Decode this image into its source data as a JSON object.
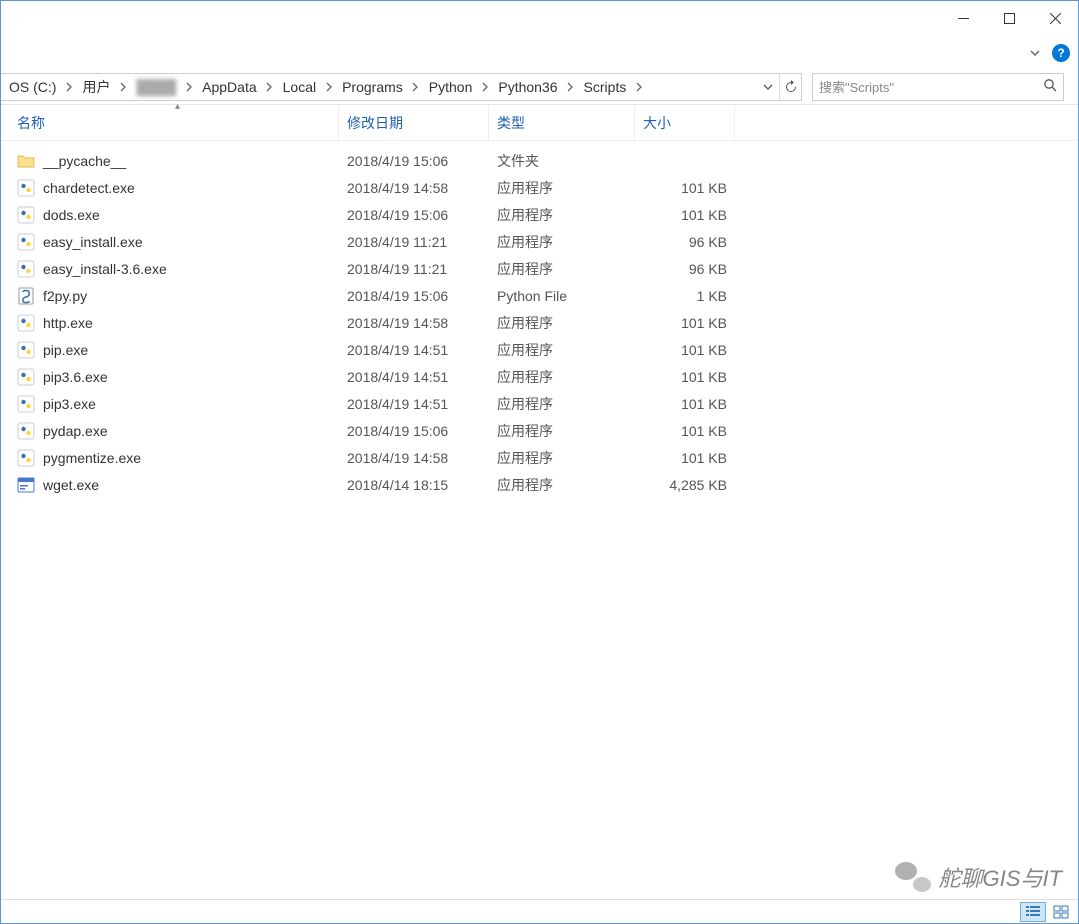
{
  "window": {
    "minimize": "—",
    "maximize": "☐",
    "close": "✕"
  },
  "help": "?",
  "breadcrumb": [
    "OS (C:)",
    "用户",
    "████",
    "AppData",
    "Local",
    "Programs",
    "Python",
    "Python36",
    "Scripts"
  ],
  "search_placeholder": "搜索\"Scripts\"",
  "columns": {
    "name": "名称",
    "date": "修改日期",
    "type": "类型",
    "size": "大小"
  },
  "files": [
    {
      "icon": "folder",
      "name": "__pycache__",
      "date": "2018/4/19 15:06",
      "type": "文件夹",
      "size": ""
    },
    {
      "icon": "exe",
      "name": "chardetect.exe",
      "date": "2018/4/19 14:58",
      "type": "应用程序",
      "size": "101 KB"
    },
    {
      "icon": "exe",
      "name": "dods.exe",
      "date": "2018/4/19 15:06",
      "type": "应用程序",
      "size": "101 KB"
    },
    {
      "icon": "exe",
      "name": "easy_install.exe",
      "date": "2018/4/19 11:21",
      "type": "应用程序",
      "size": "96 KB"
    },
    {
      "icon": "exe",
      "name": "easy_install-3.6.exe",
      "date": "2018/4/19 11:21",
      "type": "应用程序",
      "size": "96 KB"
    },
    {
      "icon": "py",
      "name": "f2py.py",
      "date": "2018/4/19 15:06",
      "type": "Python File",
      "size": "1 KB"
    },
    {
      "icon": "exe",
      "name": "http.exe",
      "date": "2018/4/19 14:58",
      "type": "应用程序",
      "size": "101 KB"
    },
    {
      "icon": "exe",
      "name": "pip.exe",
      "date": "2018/4/19 14:51",
      "type": "应用程序",
      "size": "101 KB"
    },
    {
      "icon": "exe",
      "name": "pip3.6.exe",
      "date": "2018/4/19 14:51",
      "type": "应用程序",
      "size": "101 KB"
    },
    {
      "icon": "exe",
      "name": "pip3.exe",
      "date": "2018/4/19 14:51",
      "type": "应用程序",
      "size": "101 KB"
    },
    {
      "icon": "exe",
      "name": "pydap.exe",
      "date": "2018/4/19 15:06",
      "type": "应用程序",
      "size": "101 KB"
    },
    {
      "icon": "exe",
      "name": "pygmentize.exe",
      "date": "2018/4/19 14:58",
      "type": "应用程序",
      "size": "101 KB"
    },
    {
      "icon": "wget",
      "name": "wget.exe",
      "date": "2018/4/14 18:15",
      "type": "应用程序",
      "size": "4,285 KB"
    }
  ],
  "watermark": {
    "text": "舵聊GIS与IT",
    "url": "https://blog.csdn.net/hhd1058..."
  }
}
